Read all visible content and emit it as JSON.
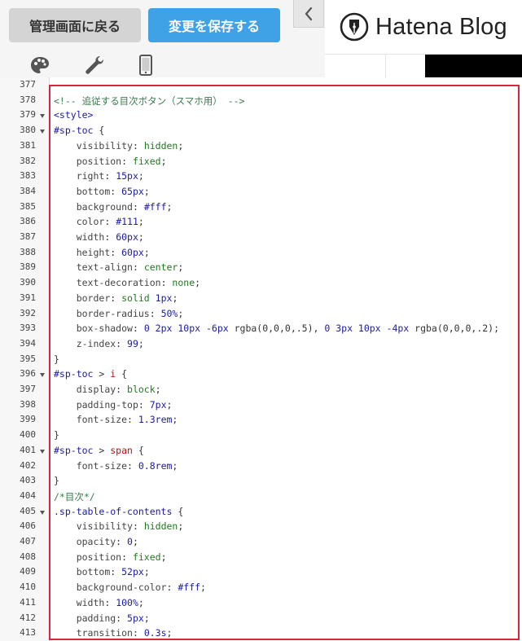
{
  "toolbar": {
    "back_label": "管理画面に戻る",
    "save_label": "変更を保存する",
    "collapse_icon": "chevron-left-icon",
    "tool_icons": [
      "palette-icon",
      "wrench-icon",
      "smartphone-icon"
    ]
  },
  "brand": {
    "name": "Hatena Blog",
    "logo_icon": "fountain-pen-nib-icon"
  },
  "colors": {
    "save_button": "#3fa1e6",
    "back_button": "#d4d4d4",
    "highlight_border": "#d7263d"
  },
  "editor": {
    "lines": [
      {
        "n": "377",
        "fold": false,
        "tokens": []
      },
      {
        "n": "378",
        "fold": false,
        "tokens": [
          {
            "t": "c",
            "v": "<!-- 追従する目次ボタン（スマホ用） -->"
          }
        ]
      },
      {
        "n": "379",
        "fold": true,
        "tokens": [
          {
            "t": "g",
            "v": "<style>"
          }
        ]
      },
      {
        "n": "380",
        "fold": true,
        "tokens": [
          {
            "t": "s",
            "v": "#sp-toc"
          },
          {
            "t": "p",
            "v": " {"
          }
        ]
      },
      {
        "n": "381",
        "fold": false,
        "tokens": [
          {
            "t": "p",
            "v": "    "
          },
          {
            "t": "k",
            "v": "visibility"
          },
          {
            "t": "p",
            "v": ": "
          },
          {
            "t": "v",
            "v": "hidden"
          },
          {
            "t": "p",
            "v": ";"
          }
        ]
      },
      {
        "n": "382",
        "fold": false,
        "tokens": [
          {
            "t": "p",
            "v": "    "
          },
          {
            "t": "k",
            "v": "position"
          },
          {
            "t": "p",
            "v": ": "
          },
          {
            "t": "v",
            "v": "fixed"
          },
          {
            "t": "p",
            "v": ";"
          }
        ]
      },
      {
        "n": "383",
        "fold": false,
        "tokens": [
          {
            "t": "p",
            "v": "    "
          },
          {
            "t": "k",
            "v": "right"
          },
          {
            "t": "p",
            "v": ": "
          },
          {
            "t": "n",
            "v": "15px"
          },
          {
            "t": "p",
            "v": ";"
          }
        ]
      },
      {
        "n": "384",
        "fold": false,
        "tokens": [
          {
            "t": "p",
            "v": "    "
          },
          {
            "t": "k",
            "v": "bottom"
          },
          {
            "t": "p",
            "v": ": "
          },
          {
            "t": "n",
            "v": "65px"
          },
          {
            "t": "p",
            "v": ";"
          }
        ]
      },
      {
        "n": "385",
        "fold": false,
        "tokens": [
          {
            "t": "p",
            "v": "    "
          },
          {
            "t": "k",
            "v": "background"
          },
          {
            "t": "p",
            "v": ": "
          },
          {
            "t": "n",
            "v": "#fff"
          },
          {
            "t": "p",
            "v": ";"
          }
        ]
      },
      {
        "n": "386",
        "fold": false,
        "tokens": [
          {
            "t": "p",
            "v": "    "
          },
          {
            "t": "k",
            "v": "color"
          },
          {
            "t": "p",
            "v": ": "
          },
          {
            "t": "n",
            "v": "#111"
          },
          {
            "t": "p",
            "v": ";"
          }
        ]
      },
      {
        "n": "387",
        "fold": false,
        "tokens": [
          {
            "t": "p",
            "v": "    "
          },
          {
            "t": "k",
            "v": "width"
          },
          {
            "t": "p",
            "v": ": "
          },
          {
            "t": "n",
            "v": "60px"
          },
          {
            "t": "p",
            "v": ";"
          }
        ]
      },
      {
        "n": "388",
        "fold": false,
        "tokens": [
          {
            "t": "p",
            "v": "    "
          },
          {
            "t": "k",
            "v": "height"
          },
          {
            "t": "p",
            "v": ": "
          },
          {
            "t": "n",
            "v": "60px"
          },
          {
            "t": "p",
            "v": ";"
          }
        ]
      },
      {
        "n": "389",
        "fold": false,
        "tokens": [
          {
            "t": "p",
            "v": "    "
          },
          {
            "t": "k",
            "v": "text-align"
          },
          {
            "t": "p",
            "v": ": "
          },
          {
            "t": "v",
            "v": "center"
          },
          {
            "t": "p",
            "v": ";"
          }
        ]
      },
      {
        "n": "390",
        "fold": false,
        "tokens": [
          {
            "t": "p",
            "v": "    "
          },
          {
            "t": "k",
            "v": "text-decoration"
          },
          {
            "t": "p",
            "v": ": "
          },
          {
            "t": "v",
            "v": "none"
          },
          {
            "t": "p",
            "v": ";"
          }
        ]
      },
      {
        "n": "391",
        "fold": false,
        "tokens": [
          {
            "t": "p",
            "v": "    "
          },
          {
            "t": "k",
            "v": "border"
          },
          {
            "t": "p",
            "v": ": "
          },
          {
            "t": "v",
            "v": "solid"
          },
          {
            "t": "p",
            "v": " "
          },
          {
            "t": "n",
            "v": "1px"
          },
          {
            "t": "p",
            "v": ";"
          }
        ]
      },
      {
        "n": "392",
        "fold": false,
        "tokens": [
          {
            "t": "p",
            "v": "    "
          },
          {
            "t": "k",
            "v": "border-radius"
          },
          {
            "t": "p",
            "v": ": "
          },
          {
            "t": "n",
            "v": "50%"
          },
          {
            "t": "p",
            "v": ";"
          }
        ]
      },
      {
        "n": "393",
        "fold": false,
        "tokens": [
          {
            "t": "p",
            "v": "    "
          },
          {
            "t": "k",
            "v": "box-shadow"
          },
          {
            "t": "p",
            "v": ": "
          },
          {
            "t": "n",
            "v": "0 2px 10px -6px"
          },
          {
            "t": "p",
            "v": " rgba(0,0,0,.5), "
          },
          {
            "t": "n",
            "v": "0 3px 10px -4px"
          },
          {
            "t": "p",
            "v": " rgba(0,0,0,.2);"
          }
        ]
      },
      {
        "n": "394",
        "fold": false,
        "tokens": [
          {
            "t": "p",
            "v": "    "
          },
          {
            "t": "k",
            "v": "z-index"
          },
          {
            "t": "p",
            "v": ": "
          },
          {
            "t": "n",
            "v": "99"
          },
          {
            "t": "p",
            "v": ";"
          }
        ]
      },
      {
        "n": "395",
        "fold": false,
        "tokens": [
          {
            "t": "p",
            "v": "}"
          }
        ]
      },
      {
        "n": "396",
        "fold": true,
        "tokens": [
          {
            "t": "s",
            "v": "#sp-toc"
          },
          {
            "t": "p",
            "v": " > "
          },
          {
            "t": "e",
            "v": "i"
          },
          {
            "t": "p",
            "v": " {"
          }
        ]
      },
      {
        "n": "397",
        "fold": false,
        "tokens": [
          {
            "t": "p",
            "v": "    "
          },
          {
            "t": "k",
            "v": "display"
          },
          {
            "t": "p",
            "v": ": "
          },
          {
            "t": "v",
            "v": "block"
          },
          {
            "t": "p",
            "v": ";"
          }
        ]
      },
      {
        "n": "398",
        "fold": false,
        "tokens": [
          {
            "t": "p",
            "v": "    "
          },
          {
            "t": "k",
            "v": "padding-top"
          },
          {
            "t": "p",
            "v": ": "
          },
          {
            "t": "n",
            "v": "7px"
          },
          {
            "t": "p",
            "v": ";"
          }
        ]
      },
      {
        "n": "399",
        "fold": false,
        "tokens": [
          {
            "t": "p",
            "v": "    "
          },
          {
            "t": "k",
            "v": "font-size"
          },
          {
            "t": "p",
            "v": ": "
          },
          {
            "t": "n",
            "v": "1.3rem"
          },
          {
            "t": "p",
            "v": ";"
          }
        ]
      },
      {
        "n": "400",
        "fold": false,
        "tokens": [
          {
            "t": "p",
            "v": "}"
          }
        ]
      },
      {
        "n": "401",
        "fold": true,
        "tokens": [
          {
            "t": "s",
            "v": "#sp-toc"
          },
          {
            "t": "p",
            "v": " > "
          },
          {
            "t": "e",
            "v": "span"
          },
          {
            "t": "p",
            "v": " {"
          }
        ]
      },
      {
        "n": "402",
        "fold": false,
        "tokens": [
          {
            "t": "p",
            "v": "    "
          },
          {
            "t": "k",
            "v": "font-size"
          },
          {
            "t": "p",
            "v": ": "
          },
          {
            "t": "n",
            "v": "0.8rem"
          },
          {
            "t": "p",
            "v": ";"
          }
        ]
      },
      {
        "n": "403",
        "fold": false,
        "tokens": [
          {
            "t": "p",
            "v": "}"
          }
        ]
      },
      {
        "n": "404",
        "fold": false,
        "tokens": [
          {
            "t": "c",
            "v": "/*目次*/"
          }
        ]
      },
      {
        "n": "405",
        "fold": true,
        "tokens": [
          {
            "t": "s",
            "v": ".sp-table-of-contents"
          },
          {
            "t": "p",
            "v": " {"
          }
        ]
      },
      {
        "n": "406",
        "fold": false,
        "tokens": [
          {
            "t": "p",
            "v": "    "
          },
          {
            "t": "k",
            "v": "visibility"
          },
          {
            "t": "p",
            "v": ": "
          },
          {
            "t": "v",
            "v": "hidden"
          },
          {
            "t": "p",
            "v": ";"
          }
        ]
      },
      {
        "n": "407",
        "fold": false,
        "tokens": [
          {
            "t": "p",
            "v": "    "
          },
          {
            "t": "k",
            "v": "opacity"
          },
          {
            "t": "p",
            "v": ": "
          },
          {
            "t": "n",
            "v": "0"
          },
          {
            "t": "p",
            "v": ";"
          }
        ]
      },
      {
        "n": "408",
        "fold": false,
        "tokens": [
          {
            "t": "p",
            "v": "    "
          },
          {
            "t": "k",
            "v": "position"
          },
          {
            "t": "p",
            "v": ": "
          },
          {
            "t": "v",
            "v": "fixed"
          },
          {
            "t": "p",
            "v": ";"
          }
        ]
      },
      {
        "n": "409",
        "fold": false,
        "tokens": [
          {
            "t": "p",
            "v": "    "
          },
          {
            "t": "k",
            "v": "bottom"
          },
          {
            "t": "p",
            "v": ": "
          },
          {
            "t": "n",
            "v": "52px"
          },
          {
            "t": "p",
            "v": ";"
          }
        ]
      },
      {
        "n": "410",
        "fold": false,
        "tokens": [
          {
            "t": "p",
            "v": "    "
          },
          {
            "t": "k",
            "v": "background-color"
          },
          {
            "t": "p",
            "v": ": "
          },
          {
            "t": "n",
            "v": "#fff"
          },
          {
            "t": "p",
            "v": ";"
          }
        ]
      },
      {
        "n": "411",
        "fold": false,
        "tokens": [
          {
            "t": "p",
            "v": "    "
          },
          {
            "t": "k",
            "v": "width"
          },
          {
            "t": "p",
            "v": ": "
          },
          {
            "t": "n",
            "v": "100%"
          },
          {
            "t": "p",
            "v": ";"
          }
        ]
      },
      {
        "n": "412",
        "fold": false,
        "tokens": [
          {
            "t": "p",
            "v": "    "
          },
          {
            "t": "k",
            "v": "padding"
          },
          {
            "t": "p",
            "v": ": "
          },
          {
            "t": "n",
            "v": "5px"
          },
          {
            "t": "p",
            "v": ";"
          }
        ]
      },
      {
        "n": "413",
        "fold": false,
        "tokens": [
          {
            "t": "p",
            "v": "    "
          },
          {
            "t": "k",
            "v": "transition"
          },
          {
            "t": "p",
            "v": ": "
          },
          {
            "t": "n",
            "v": "0.3s"
          },
          {
            "t": "p",
            "v": ";"
          }
        ]
      }
    ]
  }
}
